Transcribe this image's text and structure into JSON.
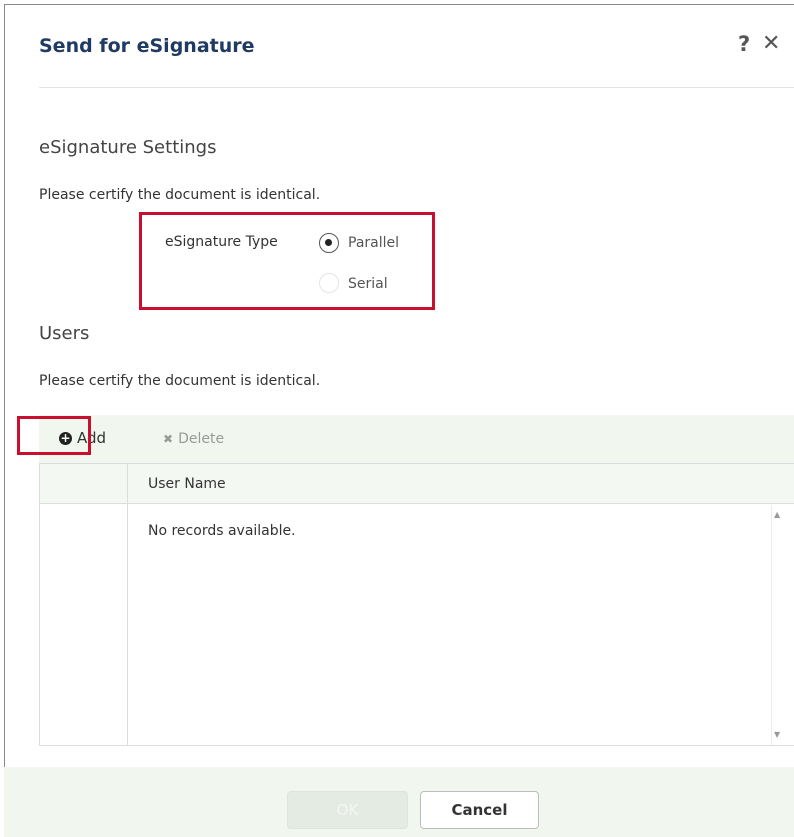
{
  "dialog": {
    "title": "Send for eSignature",
    "help_icon": "?",
    "close_icon": "✕"
  },
  "settings": {
    "title": "eSignature Settings",
    "note": "Please certify the document is identical.",
    "type_label": "eSignature Type",
    "options": [
      {
        "label": "Parallel",
        "selected": true
      },
      {
        "label": "Serial",
        "selected": false
      }
    ]
  },
  "users": {
    "title": "Users",
    "note": "Please certify the document is identical.",
    "toolbar": {
      "add_label": "Add",
      "add_icon": "+",
      "delete_label": "Delete",
      "delete_icon": "✖"
    },
    "grid": {
      "column_header": "User Name",
      "empty_text": "No records available.",
      "scroll_up": "▲",
      "scroll_down": "▼"
    }
  },
  "footer": {
    "ok_label": "OK",
    "cancel_label": "Cancel"
  },
  "colors": {
    "title": "#1f3a63",
    "highlight": "#c8102e",
    "toolbar_bg": "#f1f7ef"
  }
}
